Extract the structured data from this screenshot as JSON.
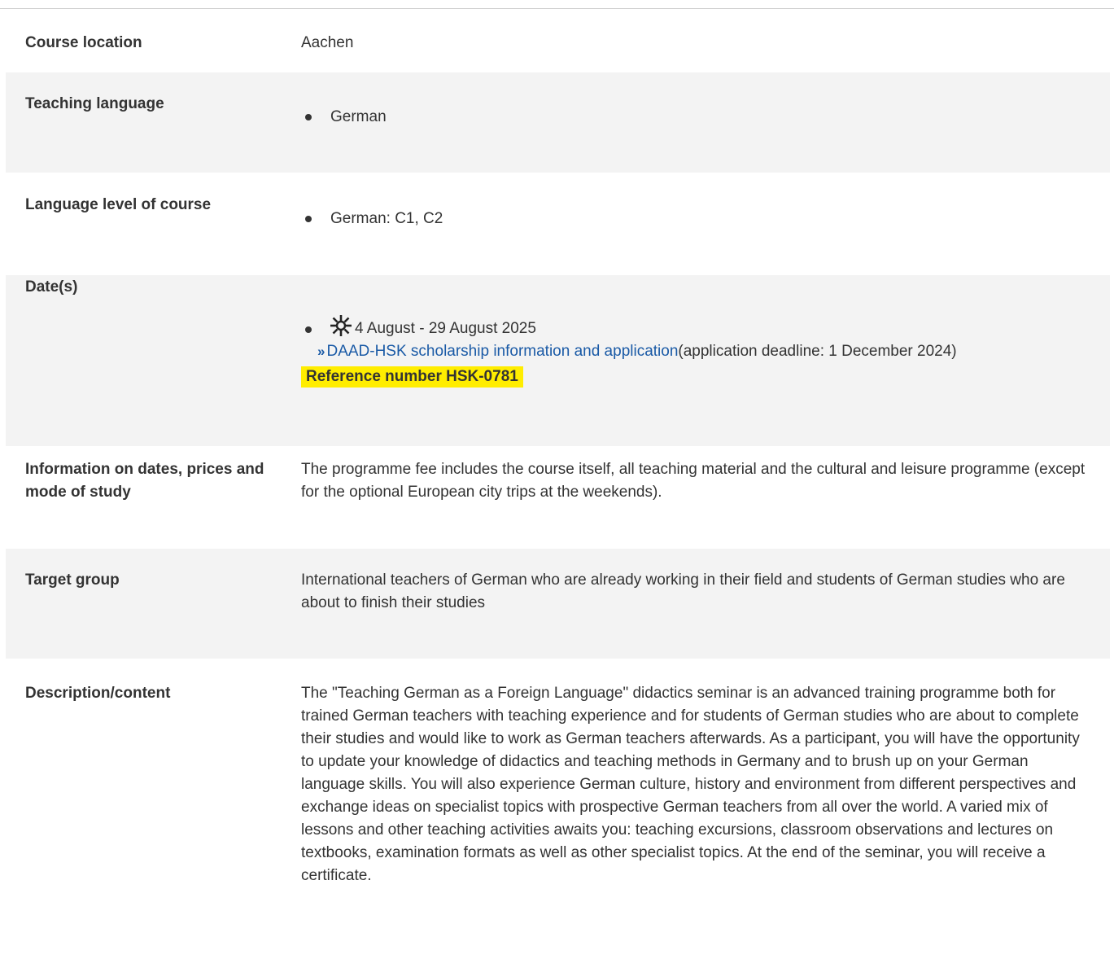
{
  "rows": [
    {
      "label": "Course location",
      "value": "Aachen"
    },
    {
      "label": "Teaching language",
      "items": [
        "German"
      ]
    },
    {
      "label": "Language level of course",
      "items": [
        "German: C1, C2"
      ]
    },
    {
      "label": "Date(s)",
      "dates": {
        "season_icon": "sun-icon",
        "range": "4 August - 29 August 2025",
        "link_text": "DAAD-HSK scholarship information and application",
        "deadline_text": "(application deadline: 1 December 2024)",
        "reference": "Reference number HSK-0781"
      }
    },
    {
      "label": "Information on dates, prices and mode of study",
      "value": "The programme fee includes the course itself, all teaching material and the cultural and leisure programme (except for the optional European city trips at the weekends)."
    },
    {
      "label": "Target group",
      "value": "International teachers of German who are already working in their field and students of German studies who are about to finish their studies"
    },
    {
      "label": "Description/content",
      "value": "The \"Teaching German as a Foreign Language\" didactics seminar is an advanced training programme both for trained German teachers with teaching experience and for students of German studies who are about to complete their studies and would like to work as German teachers afterwards. As a participant, you will have the opportunity to update your knowledge of didactics and teaching methods in Germany and to brush up on your German language skills. You will also experience German culture, history and environment from different perspectives and exchange ideas on specialist topics with prospective German teachers from all over the world. A varied mix of lessons and other teaching activities awaits you: teaching excursions, classroom observations and lectures on textbooks, examination formats as well as other specialist topics. At the end of the seminar, you will receive a certificate."
    }
  ],
  "colors": {
    "link": "#1a5aa6",
    "highlight": "#ffed00",
    "row_shade": "#f3f3f3"
  }
}
